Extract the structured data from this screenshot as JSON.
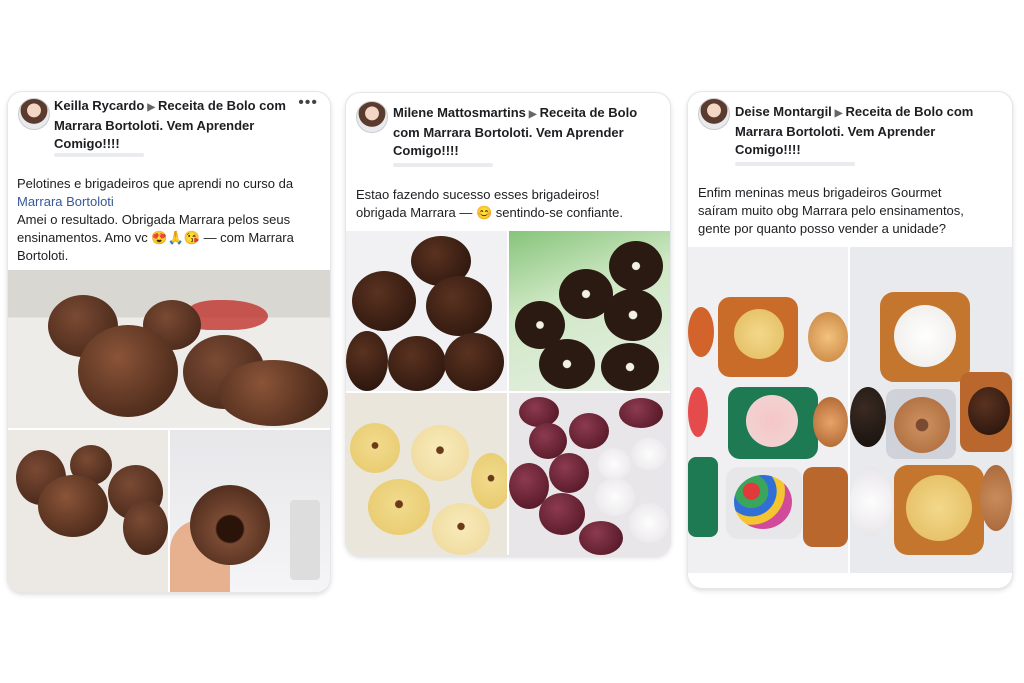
{
  "posts": [
    {
      "author": "Keilla Rycardo",
      "group": "Receita de Bolo com Marrara Bortoloti. Vem Aprender Comigo!!!!",
      "more_label": "•••",
      "text_line1": "Pelotines e brigadeiros que aprendi no curso da",
      "mention": "Marrara Bortoloti",
      "text_line2": "Amei o resultado.  Obrigada Marrara pelos seus",
      "text_line3": "ensinamentos. Amo vc 😍🙏😘 — com Marrara",
      "text_line4": "Bortoloti."
    },
    {
      "author": "Milene Mattosmartins",
      "group": "Receita de Bolo com Marrara Bortoloti. Vem Aprender Comigo!!!!",
      "text_line1": "Estao fazendo sucesso esses brigadeiros!",
      "text_line2": "obrigada Marrara — 😊 sentindo-se confiante."
    },
    {
      "author": "Deise Montargil",
      "group": "Receita de Bolo com Marrara Bortoloti. Vem Aprender Comigo!!!!",
      "text_line1": "Enfim meninas meus brigadeiros Gourmet",
      "text_line2": "saíram muito obg Marrara pelo ensinamentos,",
      "text_line3": "gente por quanto posso vender a unidade?"
    }
  ],
  "colors": {
    "link": "#385898",
    "text": "#1c1e21",
    "muted": "#65676b"
  },
  "icons": {
    "caret": "triangle-right-icon",
    "more": "three-dots-icon"
  }
}
